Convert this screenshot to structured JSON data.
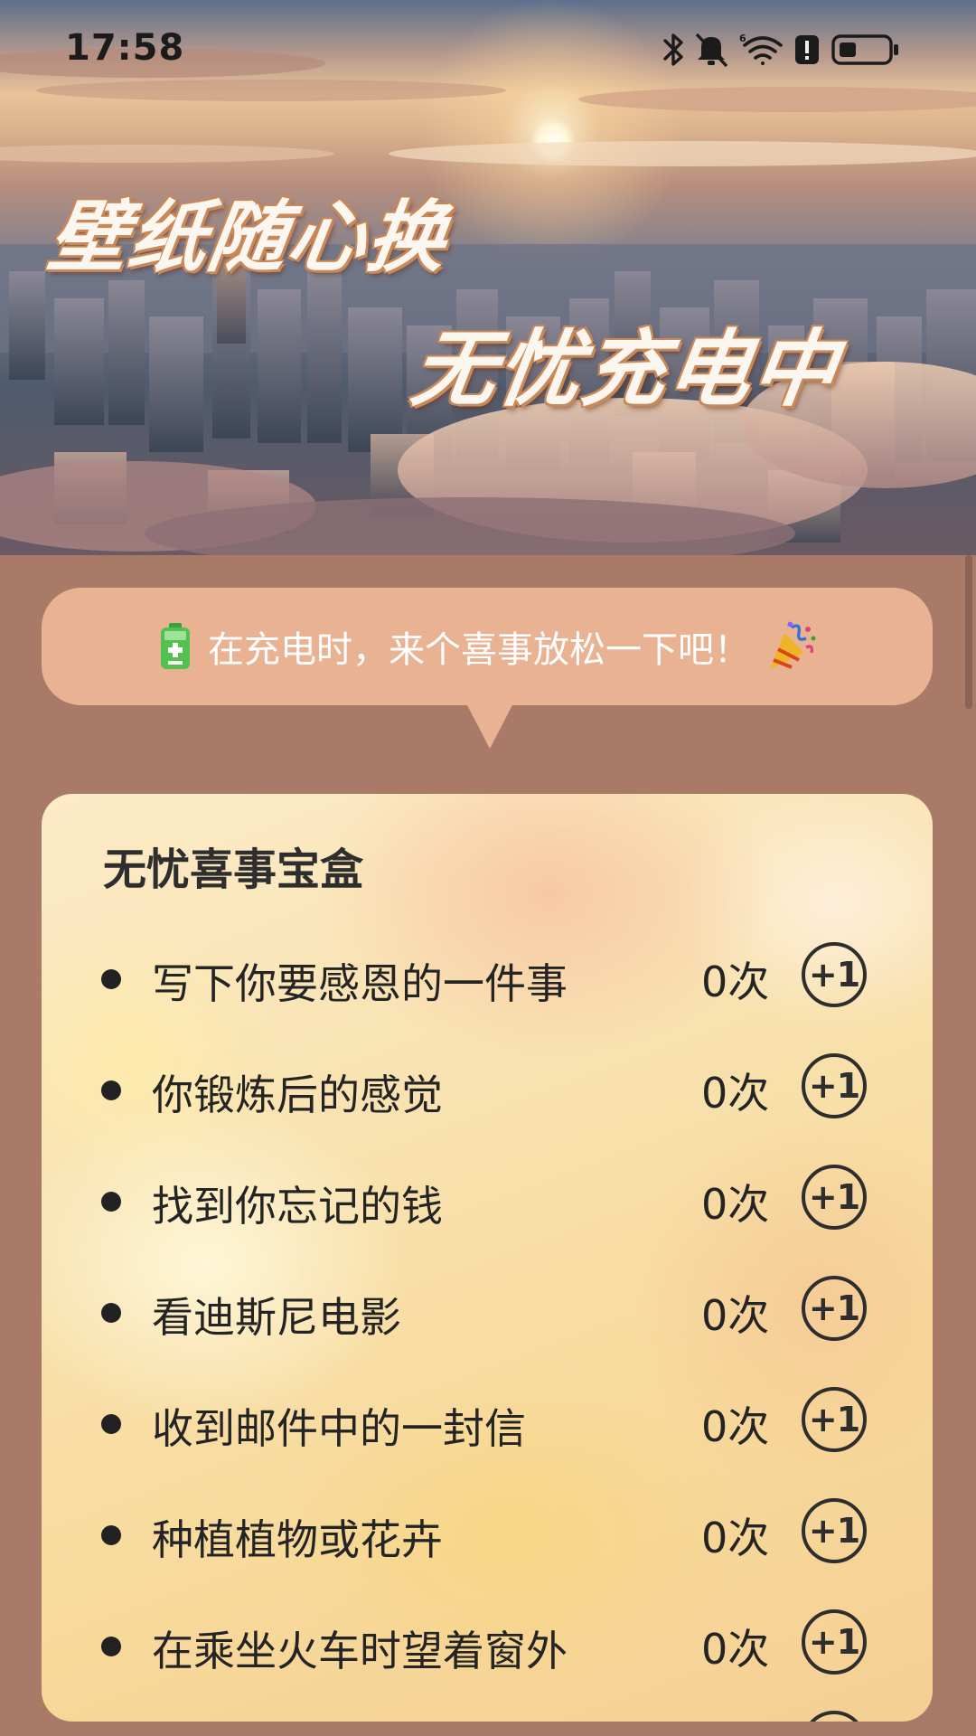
{
  "status_bar": {
    "time": "17:58",
    "icons": [
      "bluetooth-icon",
      "mute-icon",
      "wifi-icon",
      "alert-icon",
      "battery-icon"
    ]
  },
  "banner": {
    "headline_line1": "壁纸随心换",
    "headline_line2": "无忧充电中"
  },
  "tip": {
    "text": "在充电时，来个喜事放松一下吧！",
    "leading_icon": "battery-icon",
    "trailing_icon": "party-popper-icon"
  },
  "card": {
    "title": "无忧喜事宝盒",
    "items": [
      {
        "label": "写下你要感恩的一件事",
        "count": "0次",
        "button": "+1"
      },
      {
        "label": "你锻炼后的感觉",
        "count": "0次",
        "button": "+1"
      },
      {
        "label": "找到你忘记的钱",
        "count": "0次",
        "button": "+1"
      },
      {
        "label": "看迪斯尼电影",
        "count": "0次",
        "button": "+1"
      },
      {
        "label": "收到邮件中的一封信",
        "count": "0次",
        "button": "+1"
      },
      {
        "label": "种植植物或花卉",
        "count": "0次",
        "button": "+1"
      },
      {
        "label": "在乘坐火车时望着窗外",
        "count": "0次",
        "button": "+1"
      }
    ]
  },
  "colors": {
    "page_background": "#a97a68",
    "bubble": "#e9b393",
    "text_dark": "#242424"
  }
}
